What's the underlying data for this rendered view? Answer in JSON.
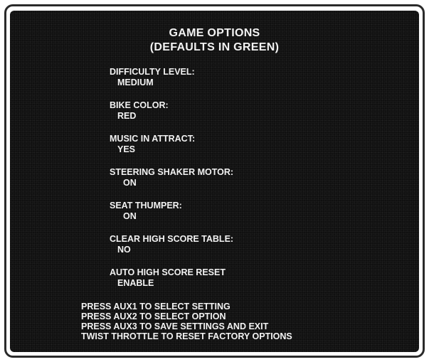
{
  "screen": {
    "title_line1": "GAME OPTIONS",
    "title_line2": "(DEFAULTS IN GREEN)"
  },
  "options": [
    {
      "label": "DIFFICULTY LEVEL:",
      "value": "MEDIUM"
    },
    {
      "label": "BIKE COLOR:",
      "value": "RED"
    },
    {
      "label": "MUSIC IN ATTRACT:",
      "value": "YES"
    },
    {
      "label": "STEERING SHAKER MOTOR:",
      "value": "ON"
    },
    {
      "label": "SEAT THUMPER:",
      "value": "ON"
    },
    {
      "label": "CLEAR HIGH SCORE TABLE:",
      "value": "NO"
    },
    {
      "label": "AUTO HIGH SCORE RESET",
      "value": "ENABLE"
    }
  ],
  "instructions": [
    "PRESS AUX1 TO SELECT SETTING",
    "PRESS AUX2 TO SELECT OPTION",
    "PRESS AUX3 TO SAVE SETTINGS AND EXIT",
    "TWIST THROTTLE TO RESET FACTORY OPTIONS"
  ],
  "colors": {
    "screen_background": "#101010",
    "text": "#f2f2f2",
    "border": "#2a2a2a"
  }
}
